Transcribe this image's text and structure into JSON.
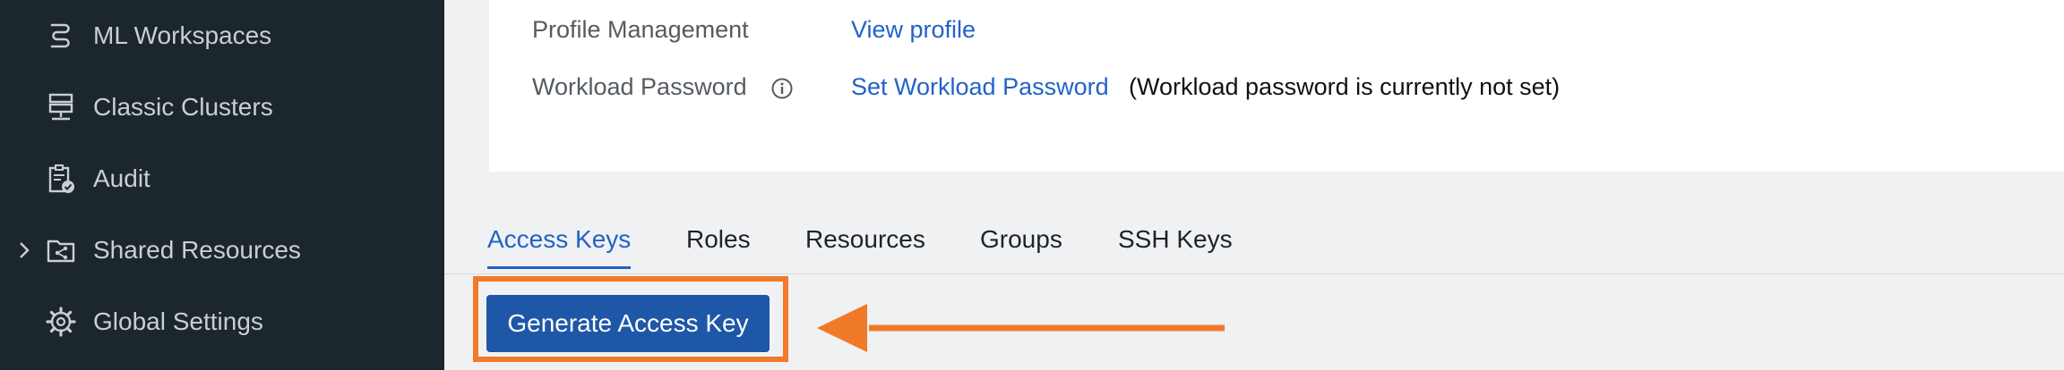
{
  "sidebar": {
    "items": [
      {
        "label": "ML Workspaces",
        "icon": "ml-workspaces-icon"
      },
      {
        "label": "Classic Clusters",
        "icon": "classic-clusters-icon"
      },
      {
        "label": "Audit",
        "icon": "audit-icon"
      },
      {
        "label": "Shared Resources",
        "icon": "folder-share-icon",
        "expandable": true
      },
      {
        "label": "Global Settings",
        "icon": "gear-icon"
      }
    ]
  },
  "profile": {
    "profile_management_label": "Profile Management",
    "view_profile_link": "View profile",
    "workload_password_label": "Workload Password",
    "set_password_link": "Set Workload Password",
    "password_status": "(Workload password is currently not set)"
  },
  "tabs": [
    {
      "label": "Access Keys",
      "active": true
    },
    {
      "label": "Roles",
      "active": false
    },
    {
      "label": "Resources",
      "active": false
    },
    {
      "label": "Groups",
      "active": false
    },
    {
      "label": "SSH Keys",
      "active": false
    }
  ],
  "actions": {
    "generate_access_key": "Generate Access Key"
  },
  "colors": {
    "sidebar_bg": "#1c262d",
    "link": "#2262c6",
    "primary_button": "#1e57a8",
    "annotation": "#f07a2a"
  }
}
